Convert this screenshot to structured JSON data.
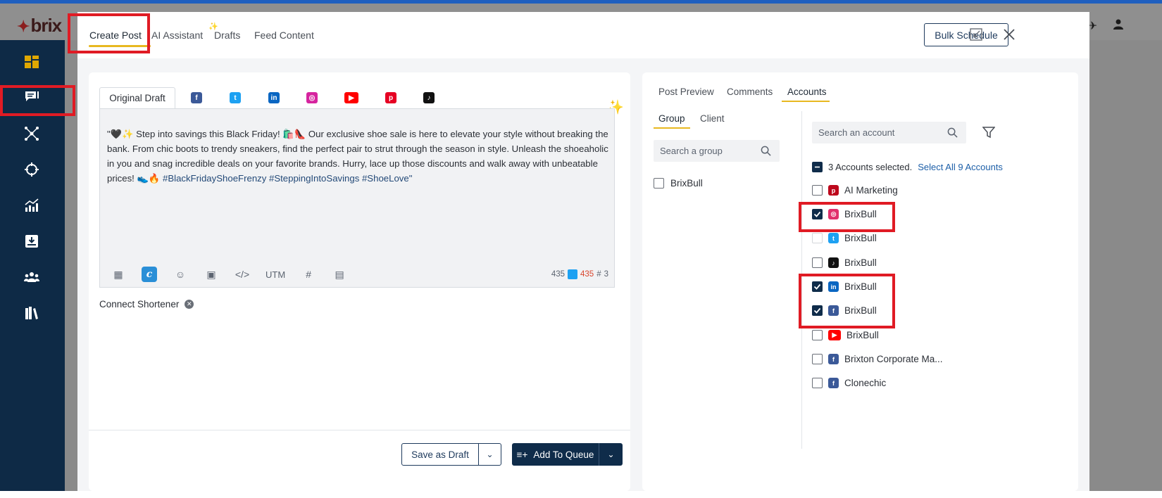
{
  "app": {
    "logo_text": "brix"
  },
  "header": {
    "tabs": [
      {
        "label": "Create Post"
      },
      {
        "label": "AI Assistant"
      },
      {
        "label": "Drafts"
      },
      {
        "label": "Feed Content"
      }
    ],
    "bulk_schedule_label": "Bulk Schedule"
  },
  "editor": {
    "original_draft_label": "Original Draft",
    "networks": [
      "facebook",
      "twitter",
      "linkedin",
      "instagram",
      "youtube",
      "pinterest",
      "tiktok"
    ],
    "post_text": "\"🖤✨ Step into savings this Black Friday! 🛍️👠 Our exclusive shoe sale is here to elevate your style without breaking the bank. From chic boots to trendy sneakers, find the perfect pair to strut through the season in style. Unleash the shoeaholic in you and snag incredible deals on your favorite brands. Hurry, lace up those discounts and walk away with unbeatable prices! 👟🔥 ",
    "post_hashtags": "#BlackFridayShoeFrenzy #SteppingIntoSavings #ShoeLove\"",
    "utm_label": "UTM",
    "count_total": "435",
    "count_twitter": "435",
    "count_hashtags": "3",
    "connect_shortener": "Connect Shortener",
    "save_draft_label": "Save as Draft",
    "add_queue_label": "Add To Queue"
  },
  "accounts_panel": {
    "tabs": [
      {
        "label": "Post Preview"
      },
      {
        "label": "Comments"
      },
      {
        "label": "Accounts"
      }
    ],
    "sub_tabs": [
      {
        "label": "Group"
      },
      {
        "label": "Client"
      }
    ],
    "group_search_placeholder": "Search a group",
    "account_search_placeholder": "Search an account",
    "groups": [
      {
        "name": "BrixBull",
        "checked": false
      }
    ],
    "selected_summary": "3 Accounts selected.",
    "select_all_label": "Select All 9 Accounts",
    "accounts": [
      {
        "name": "AI Marketing",
        "network": "pinterest",
        "checked": false
      },
      {
        "name": "BrixBull",
        "network": "instagram",
        "checked": true
      },
      {
        "name": "BrixBull",
        "network": "twitter",
        "checked": false
      },
      {
        "name": "BrixBull",
        "network": "tiktok",
        "checked": false
      },
      {
        "name": "BrixBull",
        "network": "linkedin",
        "checked": true
      },
      {
        "name": "BrixBull",
        "network": "facebook",
        "checked": true
      },
      {
        "name": "BrixBull",
        "network": "youtube",
        "checked": false
      },
      {
        "name": "Brixton Corporate Ma...",
        "network": "facebook",
        "checked": false
      },
      {
        "name": "Clonechic",
        "network": "facebook",
        "checked": false
      }
    ]
  },
  "colors": {
    "accent": "#e8b820",
    "navy": "#0f2c4a",
    "highlight_box": "#e01b24",
    "link": "#1d5fa8"
  }
}
